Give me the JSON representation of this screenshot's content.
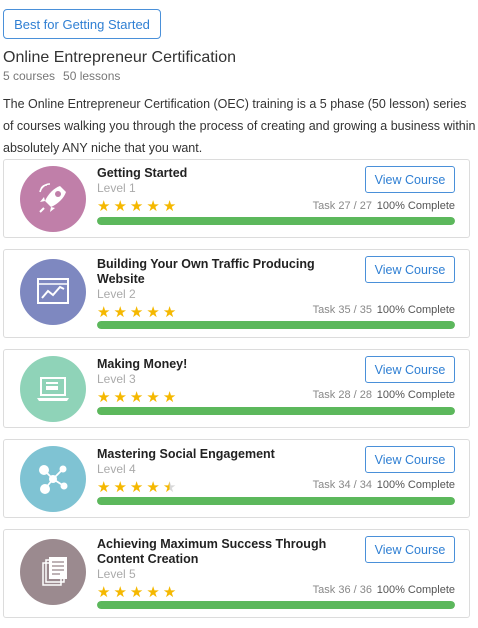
{
  "header": {
    "badge_label": "Best for Getting Started",
    "title": "Online Entrepreneur Certification",
    "courses": "5 courses",
    "lessons": "50 lessons",
    "description": "The Online Entrepreneur Certification (OEC) training is a 5 phase (50 lesson) series of courses walking you through the process of creating and growing a business within absolutely ANY niche that you want."
  },
  "courses": [
    {
      "title": "Getting Started",
      "level": "Level 1",
      "rating": 5,
      "task": "Task 27 / 27",
      "complete": "100% Complete",
      "progress": 1.0,
      "button": "View Course",
      "icon": "rocket-icon",
      "color": "#c07fa9"
    },
    {
      "title": "Building Your Own Traffic Producing Website",
      "level": "Level 2",
      "rating": 5,
      "task": "Task 35 / 35",
      "complete": "100% Complete",
      "progress": 1.0,
      "button": "View Course",
      "icon": "website-chart-icon",
      "color": "#7e88c0"
    },
    {
      "title": "Making Money!",
      "level": "Level 3",
      "rating": 5,
      "task": "Task 28 / 28",
      "complete": "100% Complete",
      "progress": 1.0,
      "button": "View Course",
      "icon": "laptop-payment-icon",
      "color": "#8fd3b8"
    },
    {
      "title": "Mastering Social Engagement",
      "level": "Level 4",
      "rating": 4.5,
      "task": "Task 34 / 34",
      "complete": "100% Complete",
      "progress": 1.0,
      "button": "View Course",
      "icon": "social-network-icon",
      "color": "#7fc3d3"
    },
    {
      "title": "Achieving Maximum Success Through Content Creation",
      "level": "Level 5",
      "rating": 5,
      "task": "Task 36 / 36",
      "complete": "100% Complete",
      "progress": 1.0,
      "button": "View Course",
      "icon": "document-stack-icon",
      "color": "#9b8a8f"
    }
  ]
}
